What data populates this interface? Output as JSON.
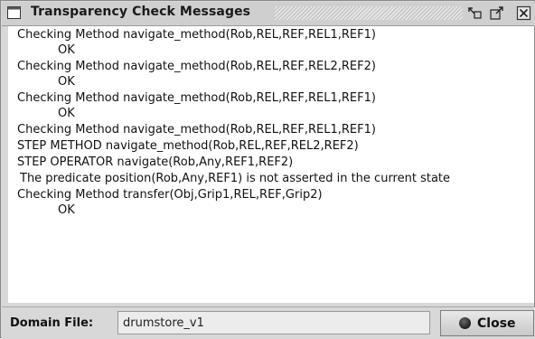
{
  "window": {
    "title": "Transparency Check Messages"
  },
  "titlebar_buttons": [
    {
      "name": "detach-icon"
    },
    {
      "name": "maximize-icon"
    },
    {
      "name": "close-window-icon"
    }
  ],
  "messages": [
    "Checking Method navigate_method(Rob,REL,REF,REL1,REF1)",
    "OK",
    "Checking Method navigate_method(Rob,REL,REF,REL2,REF2)",
    "OK",
    "Checking Method navigate_method(Rob,REL,REF,REL1,REF1)",
    "OK",
    "Checking Method navigate_method(Rob,REL,REF,REL1,REF1)",
    "STEP METHOD navigate_method(Rob,REL,REF,REL2,REF2)",
    "STEP OPERATOR navigate(Rob,Any,REF1,REF2)",
    "The predicate position(Rob,Any,REF1) is not asserted in the current state",
    "Checking Method transfer(Obj,Grip1,REL,REF,Grip2)",
    "OK"
  ],
  "footer": {
    "domain_label": "Domain File:",
    "domain_value": "drumstore_v1",
    "close_label": "Close"
  },
  "colors": {
    "window_bg": "#d8d8d8",
    "content_bg": "#ffffff"
  }
}
